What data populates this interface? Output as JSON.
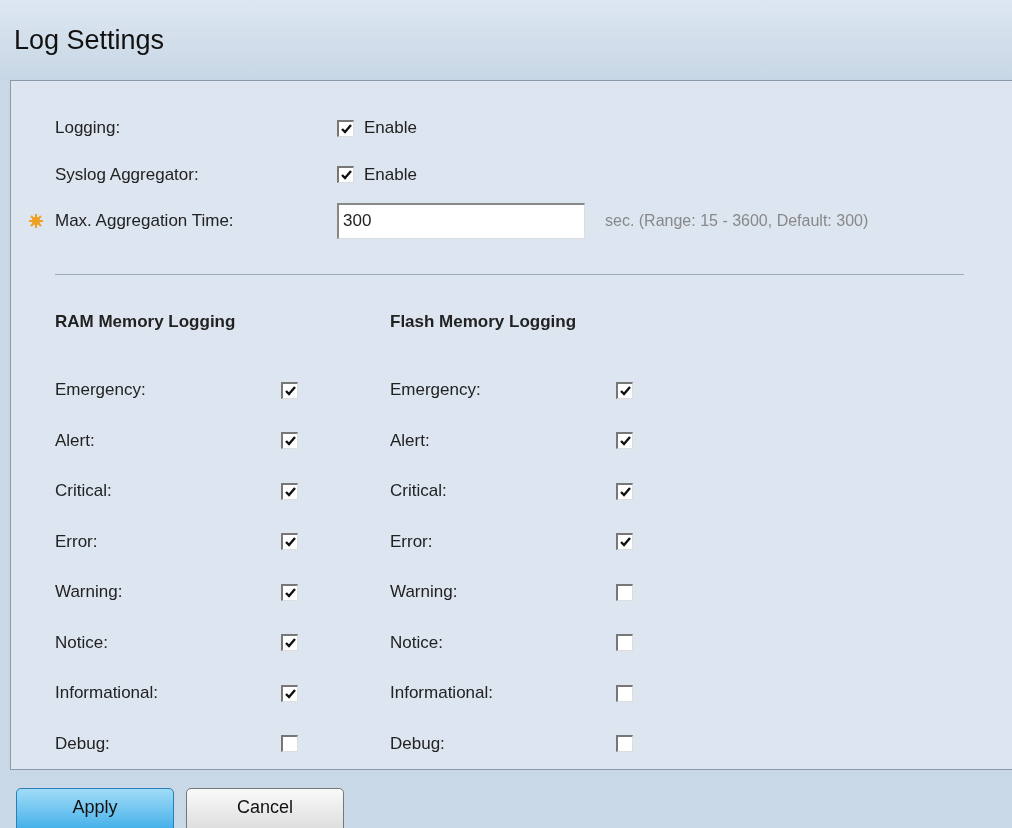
{
  "title": "Log Settings",
  "settings": [
    {
      "kind": "checkbox",
      "label": "Logging:",
      "required": false,
      "checked": true,
      "option": "Enable"
    },
    {
      "kind": "checkbox",
      "label": "Syslog Aggregator:",
      "required": false,
      "checked": true,
      "option": "Enable"
    },
    {
      "kind": "text",
      "label": "Max. Aggregation Time:",
      "required": true,
      "value": "300",
      "hint": "sec. (Range: 15 - 3600, Default: 300)"
    }
  ],
  "groups": [
    {
      "heading": "RAM Memory Logging",
      "levels": [
        {
          "label": "Emergency:",
          "checked": true
        },
        {
          "label": "Alert:",
          "checked": true
        },
        {
          "label": "Critical:",
          "checked": true
        },
        {
          "label": "Error:",
          "checked": true
        },
        {
          "label": "Warning:",
          "checked": true
        },
        {
          "label": "Notice:",
          "checked": true
        },
        {
          "label": "Informational:",
          "checked": true
        },
        {
          "label": "Debug:",
          "checked": false
        }
      ]
    },
    {
      "heading": "Flash Memory Logging",
      "levels": [
        {
          "label": "Emergency:",
          "checked": true
        },
        {
          "label": "Alert:",
          "checked": true
        },
        {
          "label": "Critical:",
          "checked": true
        },
        {
          "label": "Error:",
          "checked": true
        },
        {
          "label": "Warning:",
          "checked": false
        },
        {
          "label": "Notice:",
          "checked": false
        },
        {
          "label": "Informational:",
          "checked": false
        },
        {
          "label": "Debug:",
          "checked": false
        }
      ]
    }
  ],
  "buttons": [
    {
      "label": "Apply",
      "primary": true
    },
    {
      "label": "Cancel",
      "primary": false
    }
  ]
}
